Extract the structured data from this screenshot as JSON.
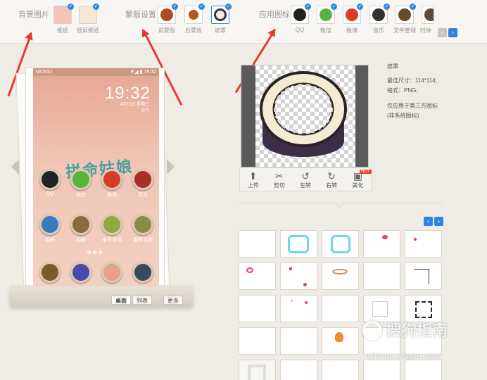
{
  "top": {
    "groups": [
      {
        "title": "背景图片",
        "items": [
          "壁纸",
          "锁屏壁纸"
        ]
      },
      {
        "title": "蒙版设置",
        "items": [
          "前蒙版",
          "后蒙版",
          "遮罩"
        ]
      },
      {
        "title": "应用图标",
        "items": [
          "QQ",
          "微信",
          "微博",
          "音乐",
          "文件管理",
          "时钟"
        ]
      }
    ],
    "check_glyph": "✓",
    "prev": "‹",
    "next": "›"
  },
  "phone": {
    "status_left": "MOXIU",
    "status_right": "▼◢ ▮ 19:32",
    "clock": "19:32",
    "clock_sub1": "4月15日 星期三",
    "clock_sub2": "天气",
    "slogan": "拼命姑娘",
    "apps": [
      {
        "label": "QQ",
        "color": "#222222"
      },
      {
        "label": "微信",
        "color": "#59b53a"
      },
      {
        "label": "微博",
        "color": "#d83b2a"
      },
      {
        "label": "音乐",
        "color": "#b02a2a"
      },
      {
        "label": "相机",
        "color": "#3a7abf"
      },
      {
        "label": "相册",
        "color": "#8a6a3a"
      },
      {
        "label": "电子市场",
        "color": "#8faa3a"
      },
      {
        "label": "魔秀主题",
        "color": "#8a8a4a"
      },
      {
        "label": "",
        "color": "#7a5a2a"
      },
      {
        "label": "",
        "color": "#4a4aaa"
      },
      {
        "label": "",
        "color": "#e8a090"
      },
      {
        "label": "",
        "color": "#3a4a5a"
      }
    ],
    "tabs": [
      "桌面",
      "列表",
      "更多"
    ]
  },
  "editor": {
    "tools": [
      {
        "icon": "⬆",
        "label": "上传"
      },
      {
        "icon": "✂",
        "label": "剪切"
      },
      {
        "icon": "↺",
        "label": "左转"
      },
      {
        "icon": "↻",
        "label": "右转"
      },
      {
        "icon": "▣",
        "label": "美化"
      }
    ],
    "hot": "HOT"
  },
  "info": {
    "title": "遮罩",
    "size": "最佳尺寸：114*114;",
    "format": "格式：PNG;",
    "note1": "仅应用于第三方图标",
    "note2": "(非系统图标)"
  },
  "watermark": {
    "text": "搜狗指南",
    "url": "zhinan.sogou.com"
  },
  "colors": {
    "accent": "#2d86e0",
    "arrow": "#e8392f"
  }
}
